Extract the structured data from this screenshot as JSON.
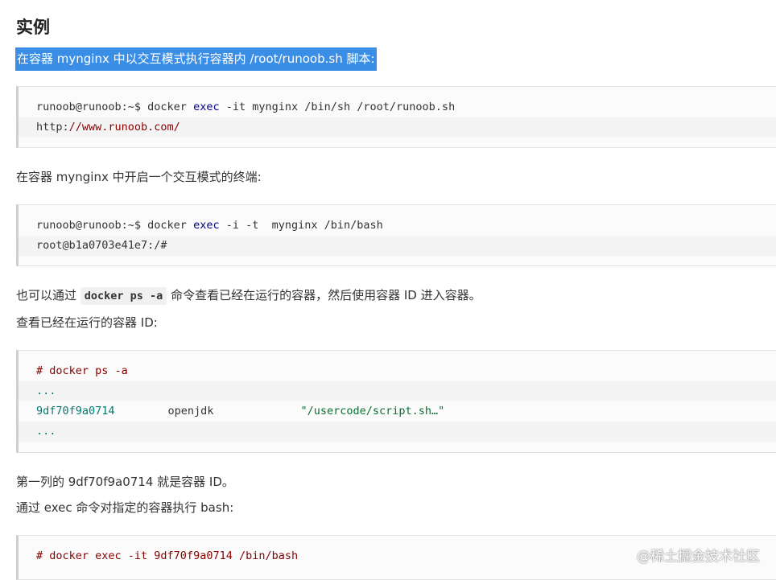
{
  "heading": "实例",
  "highlight_text": "在容器 mynginx 中以交互模式执行容器内 /root/runoob.sh 脚本:",
  "block1": {
    "prompt": "runoob@runoob:~$ ",
    "cmd1": "docker ",
    "cmd2": "exec",
    "cmd3": " -it mynginx /bin/sh /root/runoob.sh",
    "url_prefix": "http:",
    "url_rest": "//www.runoob.com/"
  },
  "para2": "在容器 mynginx 中开启一个交互模式的终端:",
  "block2": {
    "prompt": "runoob@runoob:~$ ",
    "cmd1": "docker ",
    "cmd2": "exec",
    "cmd3": " -i -t  mynginx /bin/bash",
    "root_prefix": "root@b1a0703e41e7",
    "root_suffix": ":/#"
  },
  "para3": {
    "before": "也可以通过 ",
    "code": "docker ps -a",
    "after": " 命令查看已经在运行的容器，然后使用容器 ID 进入容器。"
  },
  "para4": "查看已经在运行的容器 ID:",
  "block3": {
    "line1": "# docker ps -a",
    "line2": "...",
    "id": "9df70f9a0714",
    "image": "openjdk",
    "command": "\"/usercode/script.sh…\"",
    "line4": "..."
  },
  "para5": "第一列的 9df70f9a0714 就是容器 ID。",
  "para6": "通过 exec 命令对指定的容器执行 bash:",
  "block4": {
    "line1": "# docker exec -it 9df70f9a0714 /bin/bash"
  },
  "watermark": "@稀土掘金技术社区"
}
